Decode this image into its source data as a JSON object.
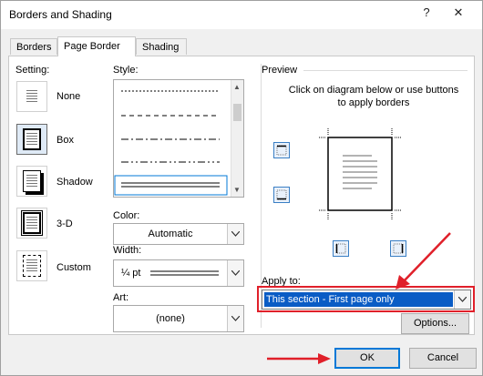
{
  "window": {
    "title": "Borders and Shading",
    "help_glyph": "?",
    "close_glyph": "✕"
  },
  "tabs": [
    {
      "label": "Borders",
      "active": false
    },
    {
      "label": "Page Border",
      "active": true
    },
    {
      "label": "Shading",
      "active": false
    }
  ],
  "setting": {
    "label": "Setting:",
    "options": [
      {
        "label": "None"
      },
      {
        "label": "Box",
        "selected": true
      },
      {
        "label": "Shadow"
      },
      {
        "label": "3-D"
      },
      {
        "label": "Custom"
      }
    ]
  },
  "style": {
    "label": "Style:"
  },
  "color": {
    "label": "Color:",
    "value": "Automatic"
  },
  "width": {
    "label": "Width:",
    "value": "¼ pt"
  },
  "art": {
    "label": "Art:",
    "value": "(none)"
  },
  "preview": {
    "label": "Preview",
    "instructions": "Click on diagram below or use buttons to apply borders"
  },
  "apply_to": {
    "label": "Apply to:",
    "value": "This section - First page only"
  },
  "buttons": {
    "options": "Options...",
    "ok": "OK",
    "cancel": "Cancel"
  },
  "colors": {
    "annotation_red": "#e0202a",
    "selection_blue": "#0a5cc5",
    "accent_blue": "#0078d7"
  }
}
